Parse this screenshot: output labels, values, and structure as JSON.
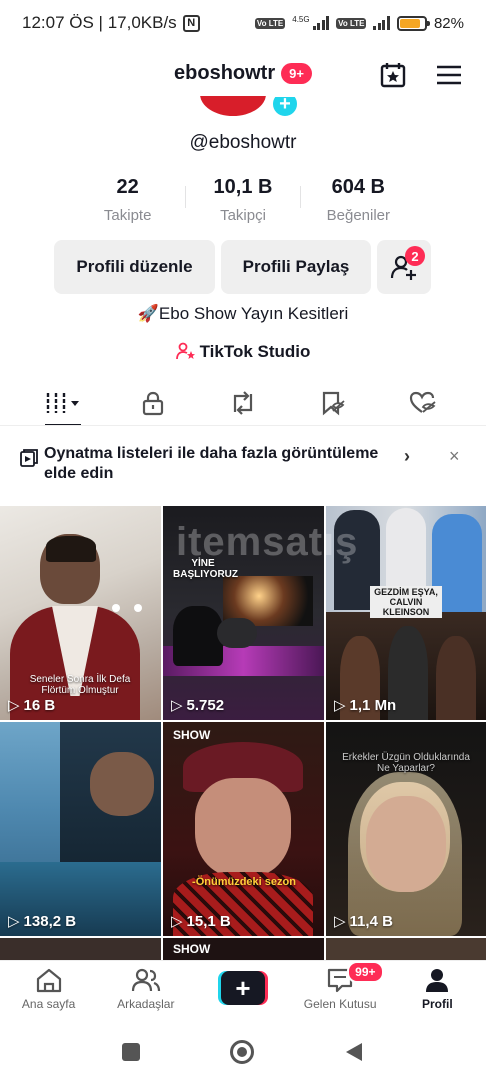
{
  "status_bar": {
    "time_network": "12:07 ÖS | 17,0KB/s",
    "nfc": "N",
    "volte1": "Vo LTE",
    "net_type": "4.5G",
    "volte2": "Vo LTE",
    "battery_level": 0.82,
    "battery_text": "82%",
    "battery_color": "#f5a623"
  },
  "header": {
    "username": "eboshowtr",
    "notification_badge": "9+",
    "calendar_icon": "calendar-star-icon",
    "menu_icon": "hamburger-menu-icon"
  },
  "profile": {
    "handle": "@eboshowtr",
    "stats": [
      {
        "value": "22",
        "label": "Takipte"
      },
      {
        "value": "10,1 B",
        "label": "Takipçi"
      },
      {
        "value": "604 B",
        "label": "Beğeniler"
      }
    ],
    "edit_button": "Profili düzenle",
    "share_button": "Profili Paylaş",
    "add_friends_badge": "2",
    "bio": "🚀Ebo Show Yayın Kesitleri",
    "studio_link": "TikTok Studio"
  },
  "tabs": [
    {
      "name": "videos",
      "icon": "grid-bars-icon",
      "active": true
    },
    {
      "name": "private",
      "icon": "lock-icon",
      "active": false
    },
    {
      "name": "reposts",
      "icon": "repost-icon",
      "active": false
    },
    {
      "name": "favorites",
      "icon": "bookmark-hidden-icon",
      "active": false
    },
    {
      "name": "liked",
      "icon": "heart-hidden-icon",
      "active": false
    }
  ],
  "playlist_banner": {
    "text": "Oynatma listeleri ile daha fazla görüntüleme elde edin",
    "chevron": "›",
    "close": "×"
  },
  "videos": [
    {
      "views": "16 B",
      "caption": "Seneler Sonra İlk Defa\nFlörtüm Olmuştur"
    },
    {
      "views": "5.752",
      "caption": "YİNE\nBAŞLIYORUZ"
    },
    {
      "views": "1,1 Mn",
      "caption": "GEZDİM EŞYA,\nCALVIN\nKLEINSON"
    },
    {
      "views": "138,2 B",
      "caption": ""
    },
    {
      "views": "15,1 B",
      "caption": "-Önümüzdeki sezon",
      "tag": "SHOW"
    },
    {
      "views": "11,4 B",
      "caption": "Erkekler Üzgün Olduklarında\nNe Yaparlar?"
    }
  ],
  "bottom_nav": [
    {
      "label": "Ana sayfa",
      "icon": "home-icon",
      "active": false
    },
    {
      "label": "Arkadaşlar",
      "icon": "friends-icon",
      "active": false
    },
    {
      "label": "",
      "icon": "plus-icon",
      "active": false
    },
    {
      "label": "Gelen Kutusu",
      "icon": "inbox-icon",
      "active": false,
      "badge": "99+"
    },
    {
      "label": "Profil",
      "icon": "profile-icon",
      "active": true
    }
  ],
  "watermark": "itemsatış"
}
